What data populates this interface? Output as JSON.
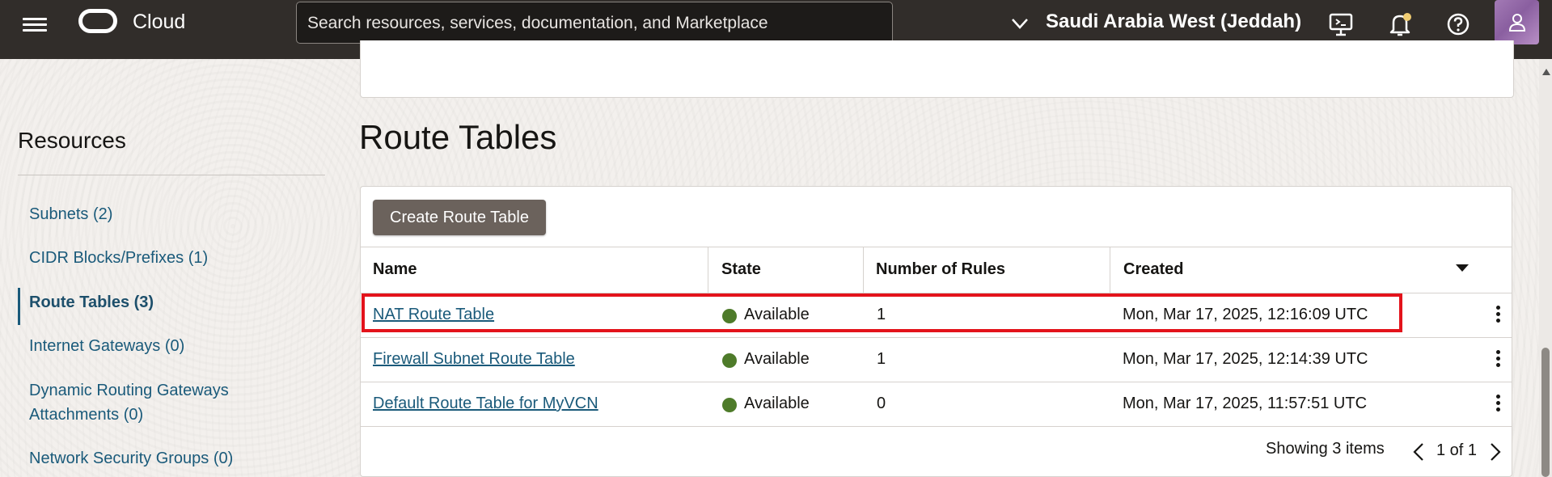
{
  "header": {
    "brand": "Cloud",
    "search_placeholder": "Search resources, services, documentation, and Marketplace",
    "region": "Saudi Arabia West (Jeddah)",
    "icons": [
      "hamburger-menu-icon",
      "oracle-logo",
      "chevron-down-icon",
      "cloud-shell-icon",
      "notification-bell-icon",
      "help-icon",
      "user-avatar-icon"
    ],
    "notification_dot_color": "#f0cc71"
  },
  "sidebar": {
    "title": "Resources",
    "items": [
      {
        "label": "Subnets (2)",
        "active": false
      },
      {
        "label": "CIDR Blocks/Prefixes (1)",
        "active": false
      },
      {
        "label": "Route Tables (3)",
        "active": true
      },
      {
        "label": "Internet Gateways (0)",
        "active": false
      },
      {
        "label": "Dynamic Routing Gateways",
        "label2": "Attachments (0)",
        "active": false
      },
      {
        "label": "Network Security Groups (0)",
        "active": false
      }
    ]
  },
  "main": {
    "title": "Route Tables",
    "create_button": "Create Route Table",
    "columns": [
      "Name",
      "State",
      "Number of Rules",
      "Created"
    ],
    "rows": [
      {
        "name": "NAT Route Table",
        "state": "Available",
        "rules": "1",
        "created": "Mon, Mar 17, 2025, 12:16:09 UTC",
        "highlighted": true
      },
      {
        "name": "Firewall Subnet Route Table",
        "state": "Available",
        "rules": "1",
        "created": "Mon, Mar 17, 2025, 12:14:39 UTC",
        "highlighted": false
      },
      {
        "name": "Default Route Table for MyVCN",
        "state": "Available",
        "rules": "0",
        "created": "Mon, Mar 17, 2025, 11:57:51 UTC",
        "highlighted": false
      }
    ],
    "footer": {
      "showing": "Showing 3 items",
      "page": "1 of 1"
    },
    "colors": {
      "accent_link": "#1a5a7a",
      "available_status": "#4e7b2a",
      "highlight_box": "#e3131b",
      "header_bg": "#312d2a"
    }
  }
}
